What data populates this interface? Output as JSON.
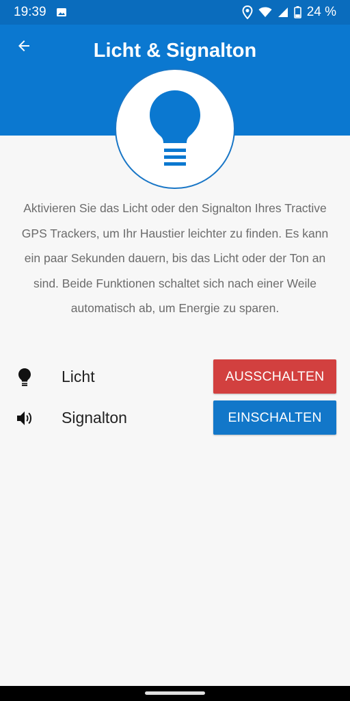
{
  "status_bar": {
    "time": "19:39",
    "battery": "24 %",
    "icons": [
      "image-icon",
      "location-icon",
      "wifi-icon",
      "signal-icon",
      "battery-icon"
    ]
  },
  "header": {
    "title": "Licht & Signalton",
    "back_icon": "arrow-left-icon",
    "hero_icon": "lightbulb-icon"
  },
  "description": "Aktivieren Sie das Licht oder den Signalton Ihres Tractive GPS Trackers, um Ihr Haustier leichter zu finden. Es kann ein paar Sekunden dauern, bis das Licht oder der Ton an sind. Beide Funktionen schaltet sich nach einer Weile automatisch ab, um Energie zu sparen.",
  "controls": [
    {
      "label": "Licht",
      "icon": "lightbulb-icon",
      "button": "AUSSCHALTEN",
      "button_color": "#d2403f"
    },
    {
      "label": "Signalton",
      "icon": "speaker-icon",
      "button": "EINSCHALTEN",
      "button_color": "#1277c9"
    }
  ],
  "colors": {
    "primary": "#0b78d0",
    "status_bar": "#0a6cbd",
    "danger": "#d2403f",
    "background": "#f7f7f7"
  }
}
